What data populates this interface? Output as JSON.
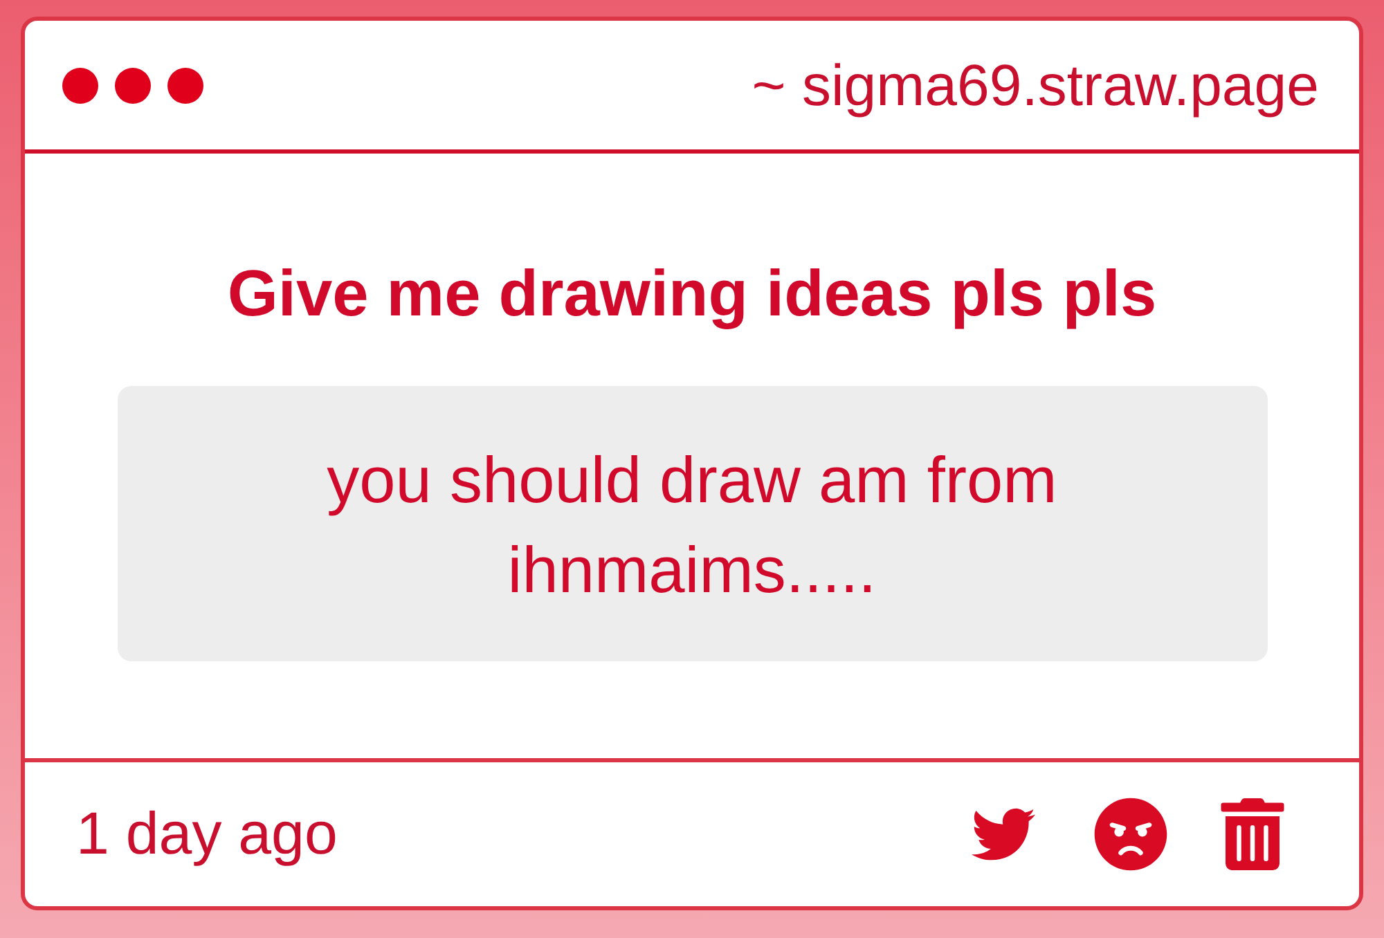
{
  "window": {
    "url": "~ sigma69.straw.page"
  },
  "post": {
    "title": "Give me drawing ideas pls pls",
    "message": "you should draw am from ihnmaims....."
  },
  "footer": {
    "time": "1 day ago",
    "actions": [
      {
        "kind": "bird"
      },
      {
        "kind": "angry"
      },
      {
        "kind": "trash"
      }
    ]
  }
}
